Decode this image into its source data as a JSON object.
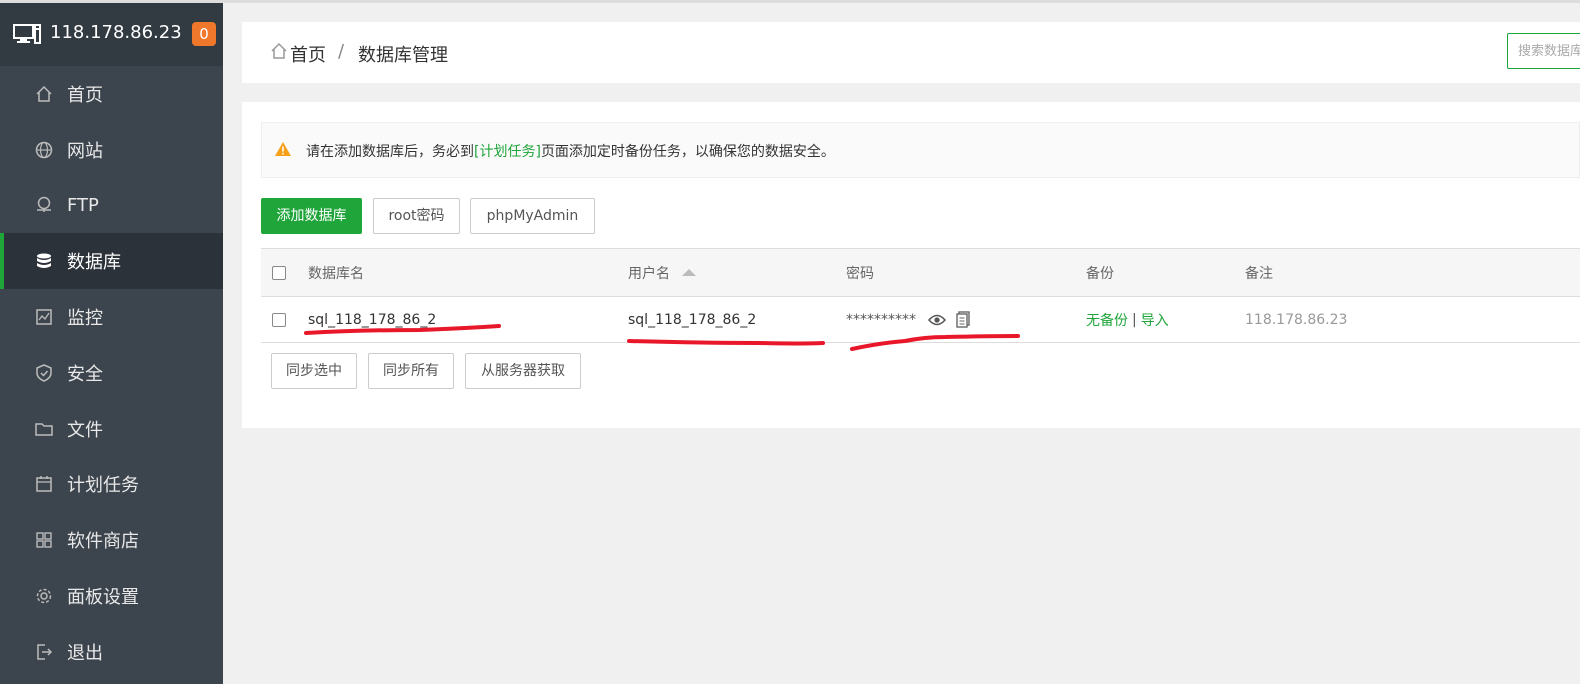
{
  "sidebar": {
    "server_ip": "118.178.86.23",
    "badge": "0",
    "items": [
      {
        "label": "首页",
        "icon": "home-icon"
      },
      {
        "label": "网站",
        "icon": "globe-icon"
      },
      {
        "label": "FTP",
        "icon": "ftp-icon"
      },
      {
        "label": "数据库",
        "icon": "database-icon",
        "active": true
      },
      {
        "label": "监控",
        "icon": "monitor-chart-icon"
      },
      {
        "label": "安全",
        "icon": "shield-icon"
      },
      {
        "label": "文件",
        "icon": "folder-icon"
      },
      {
        "label": "计划任务",
        "icon": "calendar-icon"
      },
      {
        "label": "软件商店",
        "icon": "grid-icon"
      },
      {
        "label": "面板设置",
        "icon": "gear-icon"
      },
      {
        "label": "退出",
        "icon": "logout-icon"
      }
    ]
  },
  "breadcrumb": {
    "home": "首页",
    "separator": "/",
    "current": "数据库管理",
    "search_placeholder": "搜索数据库"
  },
  "alert": {
    "before": "请在添加数据库后，务必到",
    "link": "[计划任务]",
    "after": "页面添加定时备份任务，以确保您的数据安全。"
  },
  "toolbar": {
    "add_db": "添加数据库",
    "root_pwd": "root密码",
    "phpmyadmin": "phpMyAdmin"
  },
  "table": {
    "headers": {
      "name": "数据库名",
      "user": "用户名",
      "password": "密码",
      "backup": "备份",
      "note": "备注"
    },
    "rows": [
      {
        "name": "sql_118_178_86_2",
        "user": "sql_118_178_86_2",
        "password": "**********",
        "backup_none": "无备份",
        "backup_sep": "|",
        "import": "导入",
        "note": "118.178.86.23"
      }
    ]
  },
  "bottom_buttons": {
    "sync_selected": "同步选中",
    "sync_all": "同步所有",
    "fetch_server": "从服务器获取"
  },
  "colors": {
    "sidebar_bg": "#3c444d",
    "accent_green": "#20a53a",
    "badge_orange": "#f0782d",
    "scribble_red": "#e8182a"
  }
}
